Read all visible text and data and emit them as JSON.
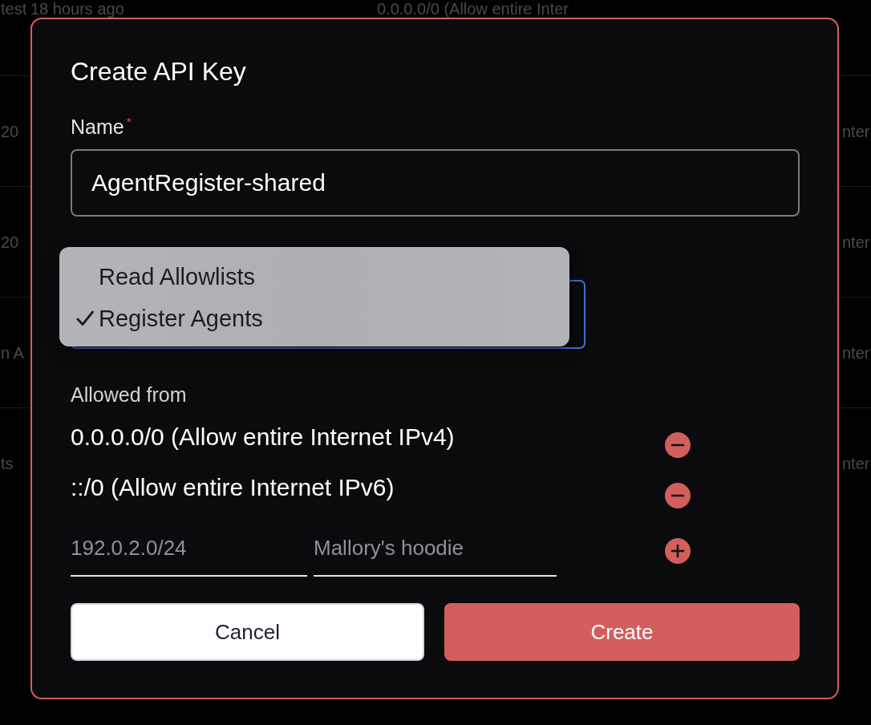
{
  "background_table": {
    "rows": [
      {
        "column_1": "test",
        "column_2": "18 hours ago",
        "column_3": "0.0.0.0/0 (Allow entire Inter"
      },
      {
        "column_1": "20",
        "column_3": "nter"
      },
      {
        "column_1": "20",
        "column_3": "nter"
      },
      {
        "column_1": "n A",
        "column_3": "nter"
      },
      {
        "column_1": "ts",
        "column_3": "nter"
      }
    ]
  },
  "dialog": {
    "title": "Create API Key",
    "name_field": {
      "label": "Name",
      "required_mark": "*",
      "value": "AgentRegister-shared"
    },
    "permissions": {
      "focused": true,
      "expanded": true,
      "options": [
        {
          "label": "Read Allowlists",
          "selected": false
        },
        {
          "label": "Register Agents",
          "selected": true
        }
      ]
    },
    "allowed_from": {
      "label": "Allowed from",
      "entries": [
        {
          "text": "0.0.0.0/0 (Allow entire Internet IPv4)"
        },
        {
          "text": "::/0 (Allow entire Internet IPv6)"
        }
      ],
      "new_entry": {
        "address_placeholder": "192.0.2.0/24",
        "description_placeholder": "Mallory's hoodie"
      }
    },
    "buttons": [
      {
        "label": "Cancel",
        "kind": "secondary"
      },
      {
        "label": "Create",
        "kind": "primary"
      }
    ]
  }
}
